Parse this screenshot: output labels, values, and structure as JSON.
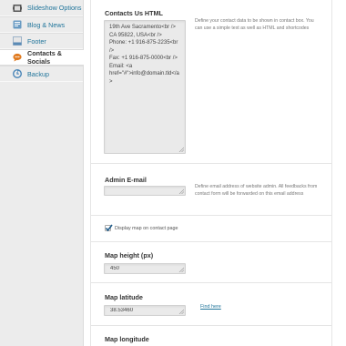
{
  "sidebar": {
    "items": [
      {
        "label": "Slideshow Options",
        "icon": "slideshow-icon"
      },
      {
        "label": "Blog & News",
        "icon": "blog-icon"
      },
      {
        "label": "Footer",
        "icon": "footer-icon"
      },
      {
        "label": "Contacts & Socials",
        "icon": "contacts-icon",
        "active": true
      },
      {
        "label": "Backup",
        "icon": "backup-icon"
      }
    ]
  },
  "contacts_html": {
    "label": "Contacts Us HTML",
    "value": "19th Ave Sacramento<br />\nCA 95822, USA<br />\nPhone: +1 916-875-2235<br />\nFax: +1 916-875-0000<br />\nEmail: <a href=\"#\">info@domain.tld</a>",
    "description": "Define your contact data to be shown in contact box. You can use a simple text as well as HTML and shortcodes"
  },
  "admin_email": {
    "label": "Admin E-mail",
    "value": "",
    "description": "Define email address of website admin. All feedbacks from contact form will be forwarded on this email address"
  },
  "display_map": {
    "label": "Display map on contact page",
    "checked": true
  },
  "map_height": {
    "label": "Map height (px)",
    "value": "450"
  },
  "map_latitude": {
    "label": "Map latitude",
    "value": "38.53460",
    "link": "Find here"
  },
  "map_longitude": {
    "label": "Map longitude"
  },
  "colors": {
    "link": "#21759b",
    "sidebar_bg": "#ececec",
    "field_bg": "#eaeaea"
  }
}
